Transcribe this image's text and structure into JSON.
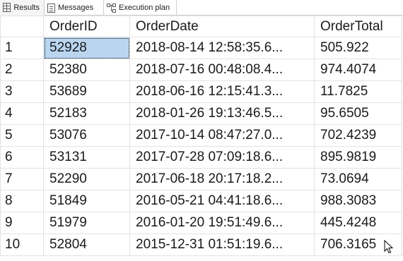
{
  "tabs": [
    {
      "label": "Results",
      "icon": "results-grid-icon",
      "active": true
    },
    {
      "label": "Messages",
      "icon": "messages-icon",
      "active": false
    },
    {
      "label": "Execution plan",
      "icon": "execution-plan-icon",
      "active": false
    }
  ],
  "grid": {
    "columns": [
      "OrderID",
      "OrderDate",
      "OrderTotal"
    ],
    "rows": [
      {
        "num": "1",
        "OrderID": "52928",
        "OrderDate": "2018-08-14 12:58:35.6...",
        "OrderTotal": "505.922"
      },
      {
        "num": "2",
        "OrderID": "52380",
        "OrderDate": "2018-07-16 00:48:08.4...",
        "OrderTotal": "974.4074"
      },
      {
        "num": "3",
        "OrderID": "53689",
        "OrderDate": "2018-06-16 12:15:41.3...",
        "OrderTotal": "11.7825"
      },
      {
        "num": "4",
        "OrderID": "52183",
        "OrderDate": "2018-01-26 19:13:46.5...",
        "OrderTotal": "95.6505"
      },
      {
        "num": "5",
        "OrderID": "53076",
        "OrderDate": "2017-10-14 08:47:27.0...",
        "OrderTotal": "702.4239"
      },
      {
        "num": "6",
        "OrderID": "53131",
        "OrderDate": "2017-07-28 07:09:18.6...",
        "OrderTotal": "895.9819"
      },
      {
        "num": "7",
        "OrderID": "52290",
        "OrderDate": "2017-06-18 20:17:18.2...",
        "OrderTotal": "73.0694"
      },
      {
        "num": "8",
        "OrderID": "51849",
        "OrderDate": "2016-05-21 04:41:18.6...",
        "OrderTotal": "988.3083"
      },
      {
        "num": "9",
        "OrderID": "51979",
        "OrderDate": "2016-01-20 19:51:49.6...",
        "OrderTotal": "445.4248"
      },
      {
        "num": "10",
        "OrderID": "52804",
        "OrderDate": "2015-12-31 01:51:19.6...",
        "OrderTotal": "706.3165"
      }
    ],
    "selected_cell": {
      "row": 0,
      "column": "OrderID"
    }
  },
  "colors": {
    "selection": "#b9d5f0",
    "gridline": "#e3e3e3"
  }
}
